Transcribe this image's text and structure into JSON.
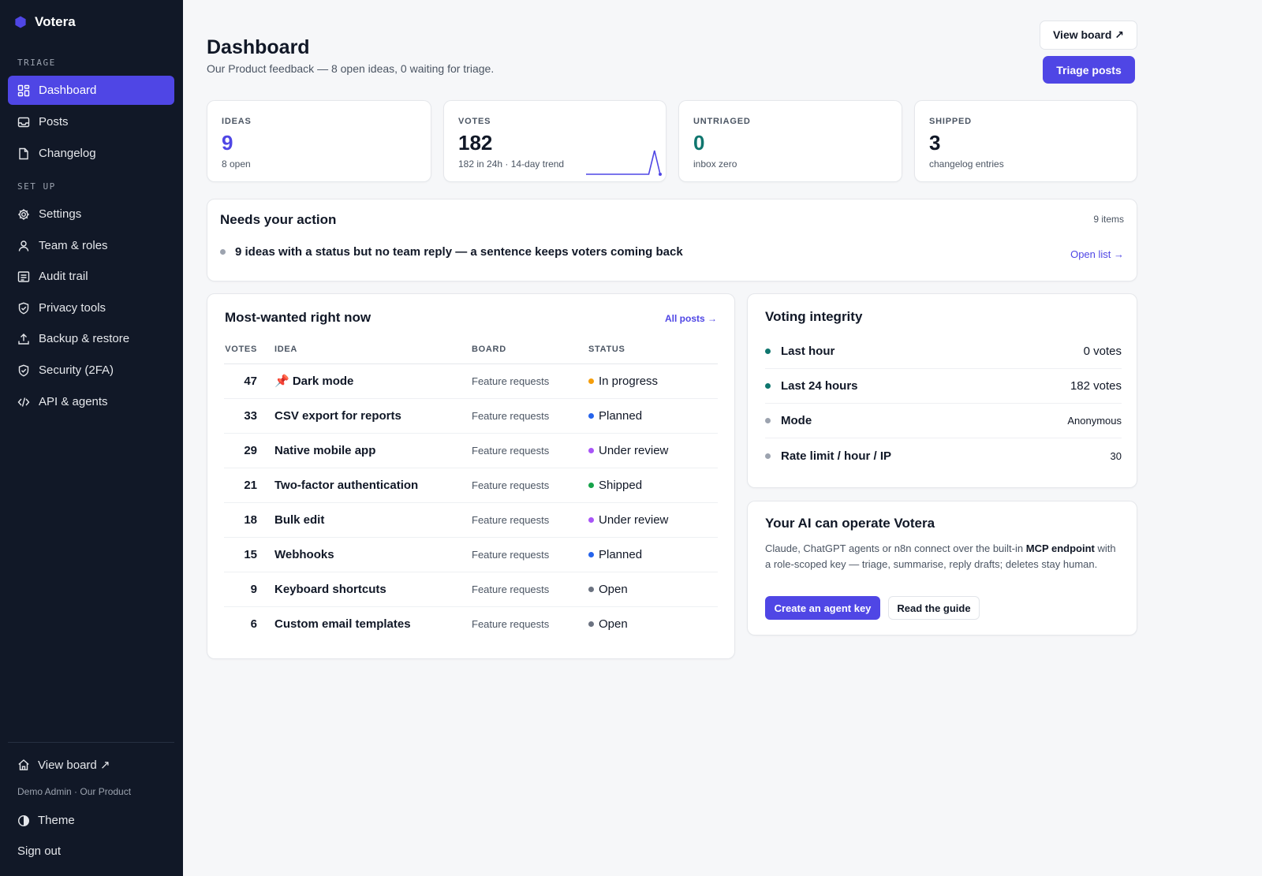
{
  "app": {
    "name": "Votera"
  },
  "sidebar": {
    "triage_label": "TRIAGE",
    "setup_label": "SET UP",
    "triage_items": [
      {
        "label": "Dashboard",
        "icon": "dashboard-icon"
      },
      {
        "label": "Posts",
        "icon": "inbox-icon"
      },
      {
        "label": "Changelog",
        "icon": "document-icon"
      }
    ],
    "setup_items": [
      {
        "label": "Settings",
        "icon": "gear-icon"
      },
      {
        "label": "Team & roles",
        "icon": "user-icon"
      },
      {
        "label": "Audit trail",
        "icon": "list-icon"
      },
      {
        "label": "Privacy tools",
        "icon": "shield-check-icon"
      },
      {
        "label": "Backup & restore",
        "icon": "upload-icon"
      },
      {
        "label": "Security (2FA)",
        "icon": "shield-check-icon"
      },
      {
        "label": "API & agents",
        "icon": "code-icon"
      }
    ],
    "footer": {
      "view_board": "View board ↗",
      "meta": "Demo Admin · Our Product",
      "theme": "Theme",
      "sign_out": "Sign out"
    }
  },
  "header": {
    "title": "Dashboard",
    "subtitle": "Our Product feedback — 8 open ideas, 0 waiting for triage.",
    "view_board": "View board ↗",
    "triage_posts": "Triage posts"
  },
  "stats": [
    {
      "label": "IDEAS",
      "value": "9",
      "note": "8 open",
      "color": "#4f46e5"
    },
    {
      "label": "VOTES",
      "value": "182",
      "note": "182 in 24h · 14-day trend",
      "color": "#111827"
    },
    {
      "label": "UNTRIAGED",
      "value": "0",
      "note": "inbox zero",
      "color": "#0f766e"
    },
    {
      "label": "SHIPPED",
      "value": "3",
      "note": "changelog entries",
      "color": "#111827"
    }
  ],
  "votes_trend": [
    0,
    0,
    0,
    0,
    0,
    0,
    0,
    0,
    0,
    0,
    0,
    0,
    182,
    0
  ],
  "needs_action": {
    "title": "Needs your action",
    "count": "9 items",
    "item": "9 ideas with a status but no team reply — a sentence keeps voters coming back",
    "link": "Open list →"
  },
  "most_wanted": {
    "title": "Most-wanted right now",
    "link": "All posts →",
    "headers": {
      "votes": "VOTES",
      "idea": "IDEA",
      "board": "BOARD",
      "status": "STATUS"
    },
    "rows": [
      {
        "votes": "47",
        "idea": "📌 Dark mode",
        "board": "Feature requests",
        "status": "In progress",
        "color": "#f59e0b"
      },
      {
        "votes": "33",
        "idea": "CSV export for reports",
        "board": "Feature requests",
        "status": "Planned",
        "color": "#2563eb"
      },
      {
        "votes": "29",
        "idea": "Native mobile app",
        "board": "Feature requests",
        "status": "Under review",
        "color": "#a855f7"
      },
      {
        "votes": "21",
        "idea": "Two-factor authentication",
        "board": "Feature requests",
        "status": "Shipped",
        "color": "#16a34a"
      },
      {
        "votes": "18",
        "idea": "Bulk edit",
        "board": "Feature requests",
        "status": "Under review",
        "color": "#a855f7"
      },
      {
        "votes": "15",
        "idea": "Webhooks",
        "board": "Feature requests",
        "status": "Planned",
        "color": "#2563eb"
      },
      {
        "votes": "9",
        "idea": "Keyboard shortcuts",
        "board": "Feature requests",
        "status": "Open",
        "color": "#6b7280"
      },
      {
        "votes": "6",
        "idea": "Custom email templates",
        "board": "Feature requests",
        "status": "Open",
        "color": "#6b7280"
      }
    ]
  },
  "integrity": {
    "title": "Voting integrity",
    "rows": [
      {
        "label": "Last hour",
        "value": "0 votes",
        "color": "#0f766e"
      },
      {
        "label": "Last 24 hours",
        "value": "182 votes",
        "color": "#0f766e"
      },
      {
        "label": "Mode",
        "value": "Anonymous",
        "color": "#9ca3af"
      },
      {
        "label": "Rate limit / hour / IP",
        "value": "30",
        "color": "#9ca3af"
      }
    ]
  },
  "ai_card": {
    "title": "Your AI can operate Votera",
    "text_before": "Claude, ChatGPT agents or n8n connect over the built-in ",
    "text_bold": "MCP endpoint",
    "text_after": " with a role-scoped key — triage, summarise, reply drafts; deletes stay human.",
    "create_key": "Create an agent key",
    "read_guide": "Read the guide"
  },
  "colors": {
    "accent": "#4f46e5",
    "sidebar_bg": "#111827",
    "teal": "#0f766e"
  }
}
